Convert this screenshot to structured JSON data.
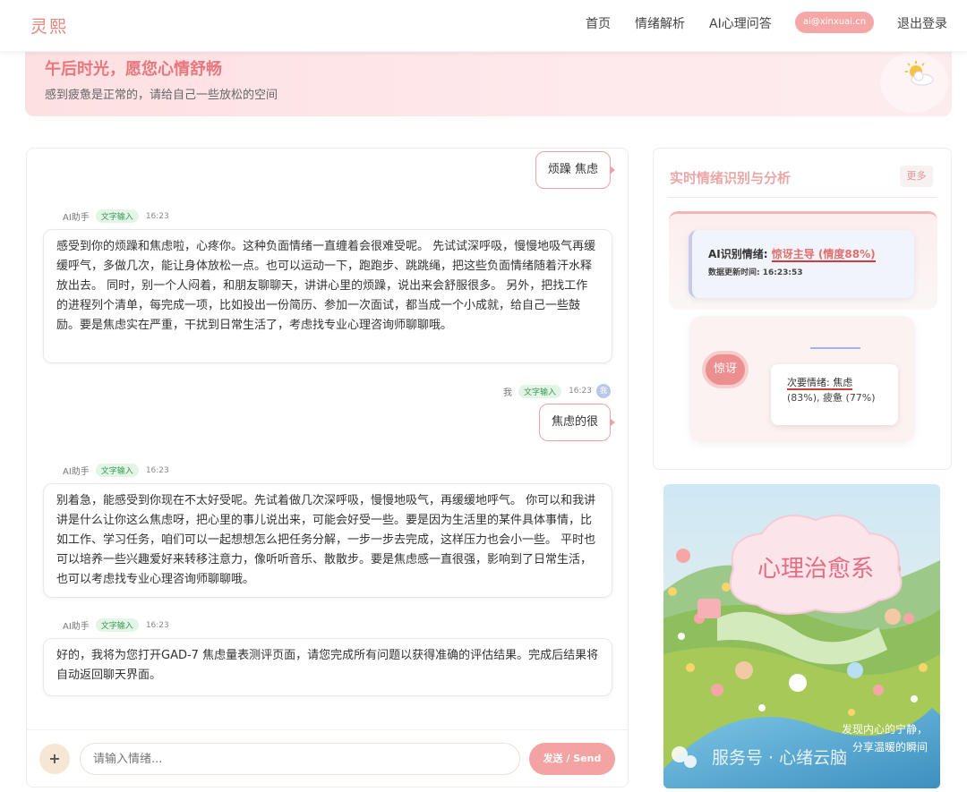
{
  "nav": {
    "logo": "灵熙",
    "items": [
      "首页",
      "情绪解析",
      "AI心理问答"
    ],
    "user": "ai@xinxuai.cn",
    "logout": "退出登录"
  },
  "banner": {
    "title": "午后时光，愿您心情舒畅",
    "subtitle": "感到疲惫是正常的，请给自己一些放松的空间"
  },
  "chat": {
    "msg1_user": "烦躁 焦虑",
    "ai_name": "AI助手",
    "tag": "文字输入",
    "time": "16:23",
    "msg2_ai": "感受到你的烦躁和焦虑啦，心疼你。这种负面情绪一直缠着会很难受呢。 先试试深呼吸，慢慢地吸气再缓缓呼气，多做几次，能让身体放松一点。也可以运动一下，跑跑步、跳跳绳，把这些负面情绪随着汗水释放出去。 同时，别一个人闷着，和朋友聊聊天，讲讲心里的烦躁，说出来会舒服很多。 另外，把找工作的进程列个清单，每完成一项，比如投出一份简历、参加一次面试，都当成一个小成就，给自己一些鼓励。要是焦虑实在严重，干扰到日常生活了，考虑找专业心理咨询师聊聊哦。",
    "me_label": "我",
    "me_avatar": "我",
    "msg3_user": "焦虑的很",
    "msg4_ai": "别着急，能感受到你现在不太好受呢。先试着做几次深呼吸，慢慢地吸气，再缓缓地呼气。 你可以和我讲讲是什么让你这么焦虑呀，把心里的事儿说出来，可能会好受一些。要是因为生活里的某件具体事情，比如工作、学习任务，咱们可以一起想想怎么把任务分解，一步一步去完成，这样压力也会小一些。 平时也可以培养一些兴趣爱好来转移注意力，像听听音乐、散散步。要是焦虑感一直很强，影响到了日常生活，也可以考虑找专业心理咨询师聊聊哦。",
    "msg5_ai": "好的，我将为您打开GAD-7 焦虑量表测评页面，请您完成所有问题以获得准确的评估结果。完成后结果将自动返回聊天界面。",
    "input_placeholder": "请输入情绪...",
    "plus": "+",
    "send": "发送 / Send"
  },
  "panel": {
    "title": "实时情绪识别与分析",
    "more": "更多",
    "ai_label": "AI识别情绪:",
    "ai_value": "惊讶主导 (情度88%)",
    "update_label": "数据更新时间:",
    "update_time": "16:23:53",
    "main_emotion": "惊讶",
    "secondary_label": "次要情绪: 焦虑",
    "secondary_detail": "(83%), 疲惫 (77%)"
  },
  "poster": {
    "title": "心理治愈系",
    "caption1": "发现内心的宁静，",
    "caption2": "分享温暖的瞬间",
    "watermark": "服务号 · 心绪云脑"
  },
  "colors": {
    "accent": "#e8787e",
    "send": "#f4a3a3",
    "tag_bg": "#e3f5e7",
    "tag_text": "#3a9a52"
  }
}
